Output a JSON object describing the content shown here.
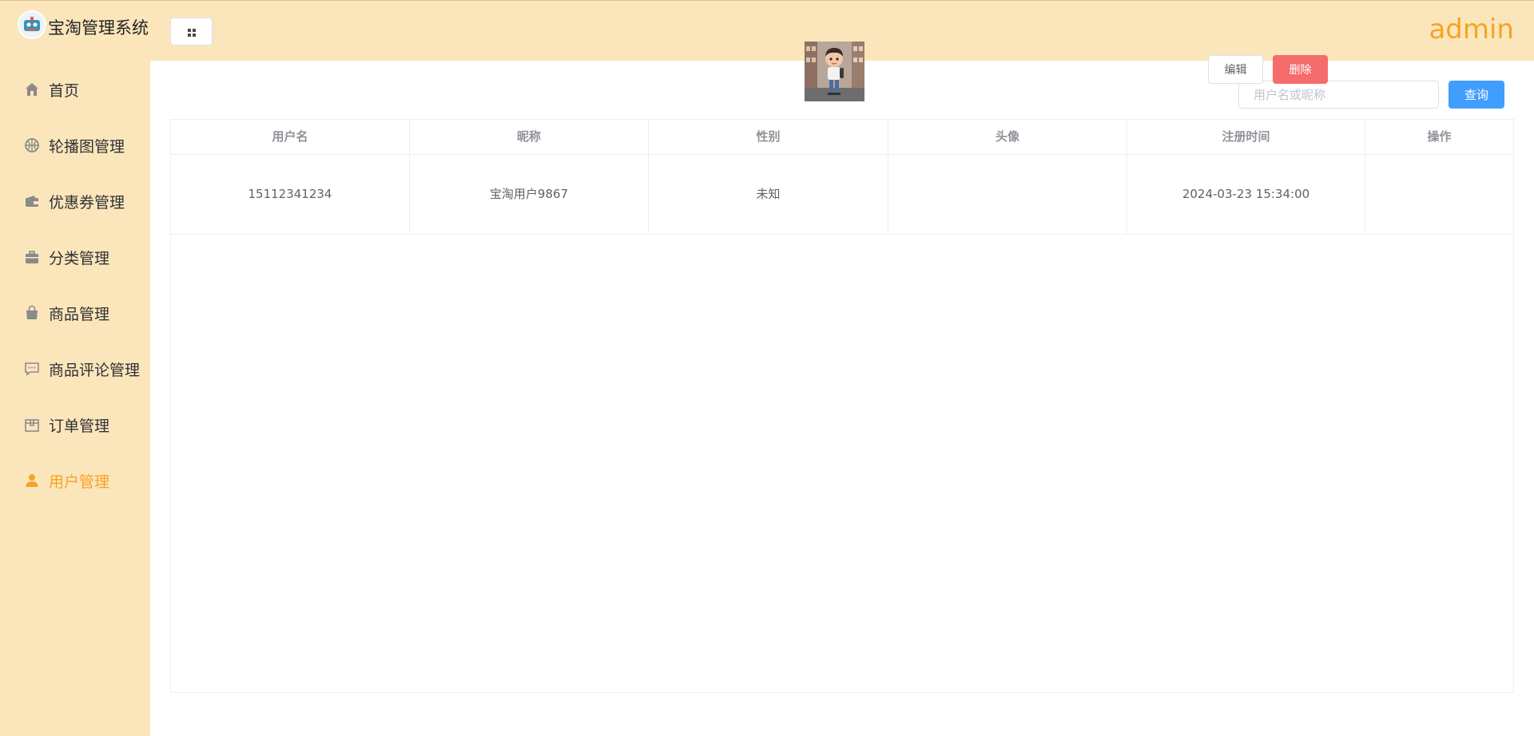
{
  "header": {
    "app_title": "宝淘管理系统",
    "user": "admin",
    "logo_icon": "app-logo-avatar",
    "toggle_icon": "grid-icon"
  },
  "sidebar": {
    "items": [
      {
        "label": "首页",
        "icon": "home-icon"
      },
      {
        "label": "轮播图管理",
        "icon": "basketball-icon"
      },
      {
        "label": "优惠券管理",
        "icon": "wallet-icon"
      },
      {
        "label": "分类管理",
        "icon": "briefcase-icon"
      },
      {
        "label": "商品管理",
        "icon": "shopping-bag-icon"
      },
      {
        "label": "商品评论管理",
        "icon": "chat-icon"
      },
      {
        "label": "订单管理",
        "icon": "box-icon"
      },
      {
        "label": "用户管理",
        "icon": "user-icon"
      }
    ],
    "active_index": 7
  },
  "toolbar": {
    "search_placeholder": "用户名或昵称",
    "search_value": "",
    "search_button": "查询"
  },
  "table": {
    "columns": [
      "用户名",
      "昵称",
      "性别",
      "头像",
      "注册时间",
      "操作"
    ],
    "rows": [
      {
        "username": "15112341234",
        "nickname": "宝淘用户9867",
        "gender": "未知",
        "avatar": "cartoon-boy-avatar",
        "register_time": "2024-03-23 15:34:00",
        "actions": [
          "编辑",
          "删除"
        ]
      }
    ]
  },
  "colors": {
    "header_bg": "#fbe6bc",
    "accent": "#f7a325",
    "primary": "#409eff",
    "danger": "#f56c6c"
  }
}
